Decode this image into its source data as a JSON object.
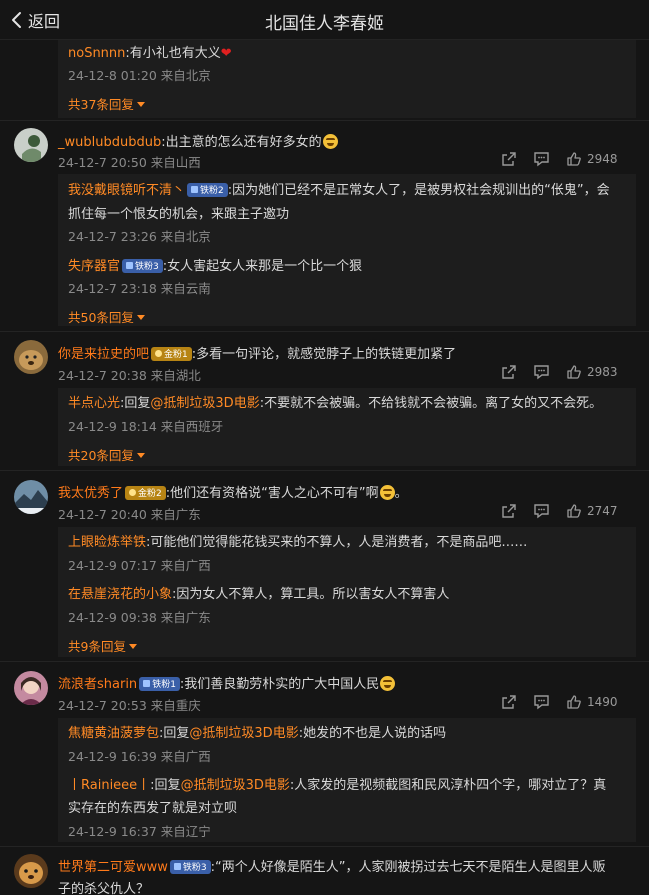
{
  "header": {
    "back_label": "返回",
    "title": "北国佳人李春姬"
  },
  "c0": {
    "reply1": {
      "user": "noSnnnn",
      "text": ":有小礼也有大义",
      "time": "24-12-8 01:20 来自北京"
    },
    "more": "共37条回复"
  },
  "c1": {
    "user": "_wublubdubdub",
    "text": ":出主意的怎么还有好多女的",
    "time": "24-12-7 20:50 来自山西",
    "likes": "2948",
    "reply1": {
      "user": "我没戴眼镜听不清丶",
      "badge": "铁粉2",
      "text": ":因为她们已经不是正常女人了，是被男权社会规训出的“伥鬼”，会",
      "text2": "抓住每一个恨女的机会，来跟主子邀功",
      "time": "24-12-7 23:26 来自北京"
    },
    "reply2": {
      "user": "失序器官",
      "badge": "铁粉3",
      "text": ":女人害起女人来那是一个比一个狠",
      "time": "24-12-7 23:18 来自云南"
    },
    "more": "共50条回复"
  },
  "c2": {
    "user": "你是来拉史的吧",
    "badge": "金粉1",
    "text": ":多看一句评论，就感觉脖子上的铁链更加紧了",
    "time": "24-12-7 20:38 来自湖北",
    "likes": "2983",
    "reply1": {
      "user": "半点心光",
      "prefix": ":回复",
      "mention": "@抵制垃圾3D电影",
      "text": ":不要就不会被骗。不给钱就不会被骗。离了女的又不会死。",
      "time": "24-12-9 18:14 来自西班牙"
    },
    "more": "共20条回复"
  },
  "c3": {
    "user": "我太优秀了",
    "badge": "金粉2",
    "text": ":他们还有资格说“害人之心不可有”啊",
    "text_end": "。",
    "time": "24-12-7 20:40 来自广东",
    "likes": "2747",
    "reply1": {
      "user": "上眼睑炼举铁",
      "text": ":可能他们觉得能花钱买来的不算人，人是消费者，不是商品吧……",
      "time": "24-12-9 07:17 来自广西"
    },
    "reply2": {
      "user": "在悬崖浇花的小象",
      "text": ":因为女人不算人，算工具。所以害女人不算害人",
      "time": "24-12-9 09:38 来自广东"
    },
    "more": "共9条回复"
  },
  "c4": {
    "user": "流浪者sharin",
    "badge": "铁粉1",
    "text": ":我们善良勤劳朴实的广大中国人民",
    "time": "24-12-7 20:53 来自重庆",
    "likes": "1490",
    "reply1": {
      "user": "焦糖黄油菠萝包",
      "prefix": ":回复",
      "mention": "@抵制垃圾3D电影",
      "text": ":她发的不也是人说的话吗",
      "time": "24-12-9 16:39 来自广西"
    },
    "reply2": {
      "user": "丨Rainieee丨",
      "prefix": ":回复",
      "mention": "@抵制垃圾3D电影",
      "text": ":人家发的是视频截图和民风淳朴四个字，哪对立了？真",
      "text2": "实存在的东西发了就是对立呗",
      "time": "24-12-9 16:37 来自辽宁"
    }
  },
  "c5": {
    "user": "世界第二可爱www",
    "badge": "铁粉3",
    "text": ":“两个人好像是陌生人”，人家刚被拐过去七天不是陌生人是图里人贩",
    "text2": "子的杀父仇人？"
  },
  "colors": {
    "background": "#151515",
    "reply_box": "#1d1d1d",
    "accent": "#ff8a25",
    "meta": "#8a8a8a"
  },
  "icons": [
    "back-chevron-icon",
    "share-icon",
    "comment-icon",
    "like-icon",
    "chevron-down-icon"
  ]
}
